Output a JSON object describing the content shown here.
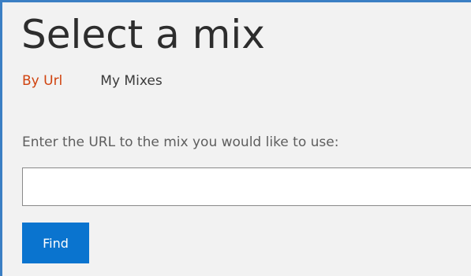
{
  "page": {
    "title": "Select a mix"
  },
  "tabs": [
    {
      "label": "By Url",
      "active": true
    },
    {
      "label": "My Mixes",
      "active": false
    }
  ],
  "form": {
    "prompt": "Enter the URL to the mix you would like to use:",
    "url_value": "",
    "url_placeholder": "",
    "find_label": "Find"
  },
  "colors": {
    "accent_border": "#3b7fc4",
    "active_tab": "#d0430f",
    "button_bg": "#0a74cf",
    "panel_bg": "#f2f2f2"
  }
}
